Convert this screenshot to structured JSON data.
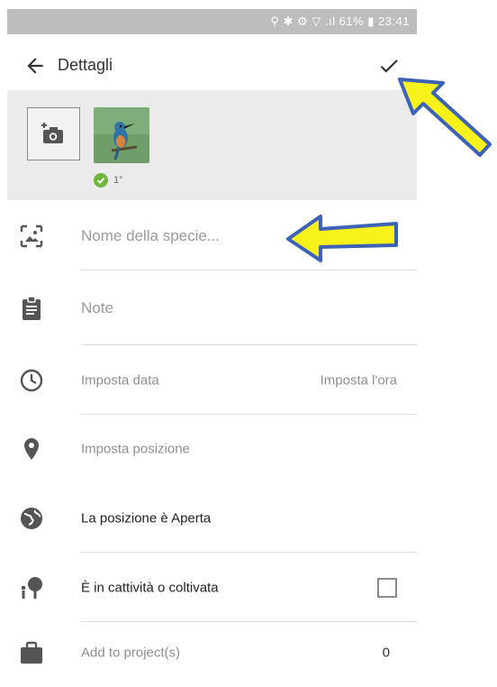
{
  "status_bar": {
    "text": "⚲ ✱ ⚙ ▽ .ıl 61% ▮ 23:41"
  },
  "app_bar": {
    "title": "Dettagli"
  },
  "photos": {
    "badge_text": "1°",
    "thumbnail": "bird-photo"
  },
  "rows": {
    "species": {
      "placeholder": "Nome della specie...",
      "icon": "image-frame-icon"
    },
    "notes": {
      "placeholder": "Note",
      "icon": "clipboard-icon"
    },
    "date": {
      "label": "Imposta data",
      "time_label": "Imposta l'ora",
      "icon": "clock-icon"
    },
    "location": {
      "label": "Imposta posizione",
      "icon": "location-pin-icon"
    },
    "visibility": {
      "label": "La posizione è Aperta",
      "icon": "globe-icon"
    },
    "captive": {
      "label": "È in cattività o coltivata",
      "checked": false,
      "icon": "tree-person-icon"
    },
    "projects": {
      "label": "Add to project(s)",
      "count": "0",
      "icon": "briefcase-icon"
    }
  },
  "colors": {
    "annotation_arrow_fill": "#f7f21a",
    "annotation_arrow_stroke": "#3b62b6",
    "badge_green": "#70b43a"
  }
}
